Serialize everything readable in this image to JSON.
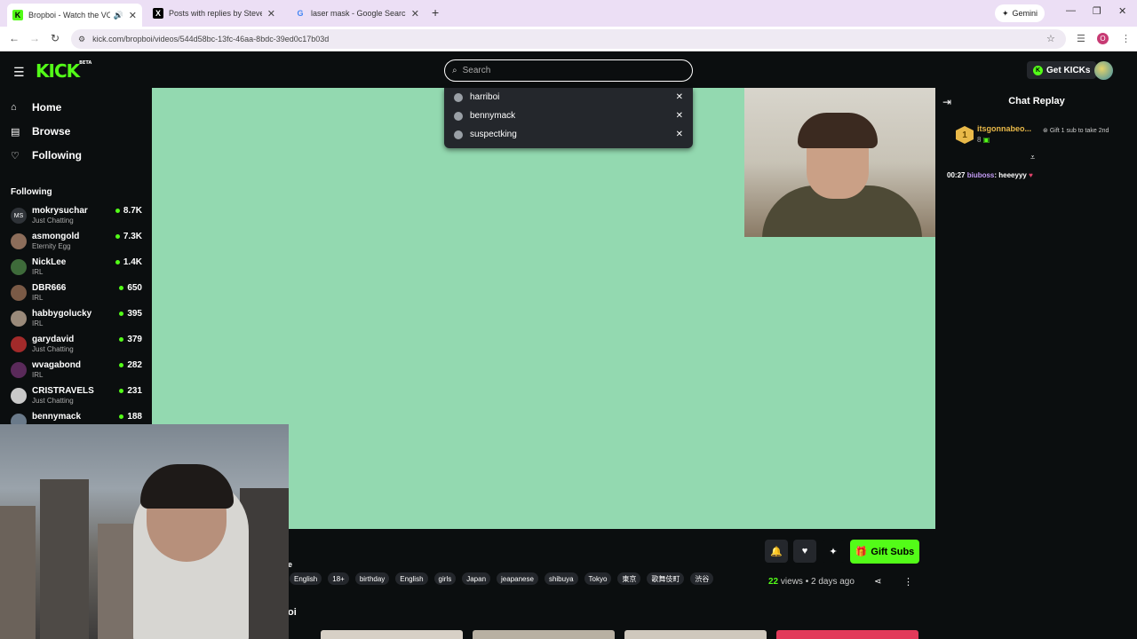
{
  "browser": {
    "tabs": [
      {
        "title": "Bropboi - Watch the VOD o",
        "favicon": "K",
        "active": true
      },
      {
        "title": "Posts with replies by Steven - S",
        "favicon": "X",
        "active": false
      },
      {
        "title": "laser mask - Google Search",
        "favicon": "G",
        "active": false
      }
    ],
    "gemini_label": "Gemini",
    "url": "kick.com/bropboi/videos/544d58bc-13fc-46aa-8bdc-39ed0c17b03d",
    "profile_initial": "O"
  },
  "header": {
    "logo": "KICK",
    "logo_badge": "BETA",
    "search_placeholder": "Search",
    "get_kicks_label": "Get KICKs"
  },
  "search_history": [
    {
      "label": "harriboi"
    },
    {
      "label": "bennymack"
    },
    {
      "label": "suspectking"
    }
  ],
  "sidebar": {
    "nav": [
      {
        "label": "Home",
        "icon": "home-icon"
      },
      {
        "label": "Browse",
        "icon": "browse-icon"
      },
      {
        "label": "Following",
        "icon": "heart-icon"
      }
    ],
    "following_heading": "Following",
    "following": [
      {
        "name": "mokrysuchar",
        "category": "Just Chatting",
        "viewers": "8.7K",
        "initials": "MS"
      },
      {
        "name": "asmongold",
        "category": "Eternity Egg",
        "viewers": "7.3K",
        "initials": ""
      },
      {
        "name": "NickLee",
        "category": "IRL",
        "viewers": "1.4K",
        "initials": ""
      },
      {
        "name": "DBR666",
        "category": "IRL",
        "viewers": "650",
        "initials": ""
      },
      {
        "name": "habbygolucky",
        "category": "IRL",
        "viewers": "395",
        "initials": ""
      },
      {
        "name": "garydavid",
        "category": "Just Chatting",
        "viewers": "379",
        "initials": ""
      },
      {
        "name": "wvagabond",
        "category": "IRL",
        "viewers": "282",
        "initials": ""
      },
      {
        "name": "CRISTRAVELS",
        "category": "Just Chatting",
        "viewers": "231",
        "initials": ""
      },
      {
        "name": "bennymack",
        "category": "",
        "viewers": "188",
        "initials": ""
      }
    ]
  },
  "chat": {
    "title": "Chat Replay",
    "gift_leader": {
      "rank": "1",
      "user": "itsgonnabeo...",
      "count": "8",
      "hint": "Gift 1 sub to take 2nd"
    },
    "messages": [
      {
        "time": "00:27",
        "user": "biuboss",
        "text": "heeeyyy"
      }
    ]
  },
  "video_info": {
    "gift_subs_label": "Gift Subs",
    "tags": [
      "English",
      "18+",
      "birthday",
      "English",
      "girls",
      "Japan",
      "jeapanese",
      "shibuya",
      "Tokyo",
      "東京",
      "歌舞伎町",
      "渋谷"
    ],
    "views_count": "22",
    "views_label": "views",
    "separator": "•",
    "posted": "2 days ago",
    "title_fragment": "e",
    "section_fragment": "oi"
  },
  "colors": {
    "brand": "#53fc18",
    "background": "#0b0e0f",
    "video_bg": "#93d9b0"
  }
}
